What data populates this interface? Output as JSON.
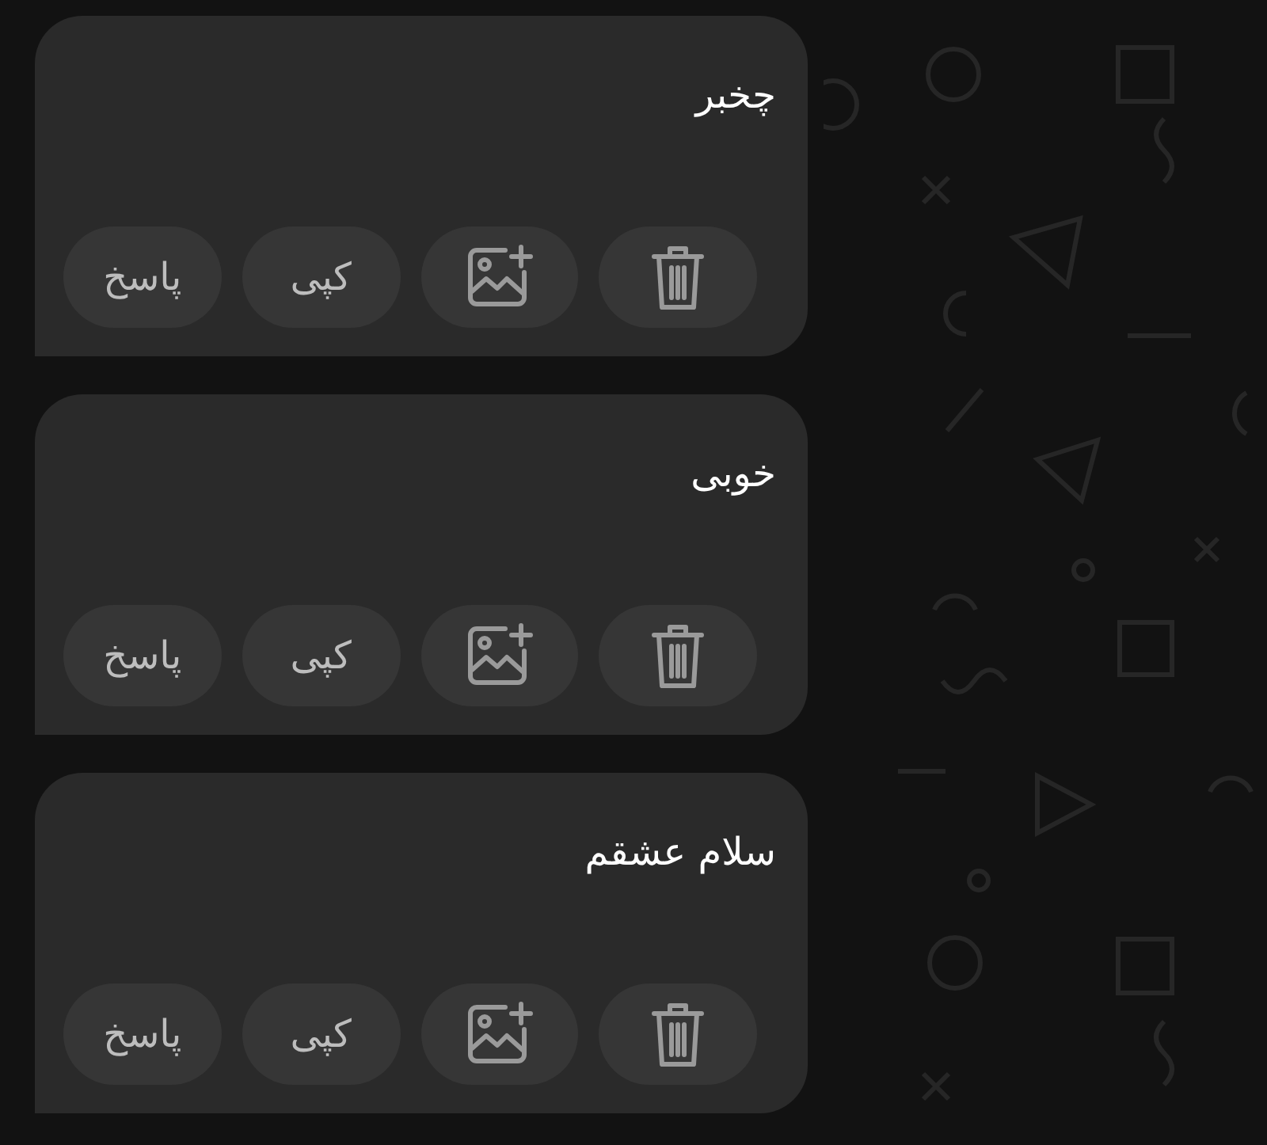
{
  "messages": [
    {
      "text": "چخبر",
      "actions": [
        {
          "kind": "delete"
        },
        {
          "kind": "add-image"
        },
        {
          "kind": "text",
          "label": "کپی"
        },
        {
          "kind": "text",
          "label": "پاسخ"
        }
      ]
    },
    {
      "text": "خوبی",
      "actions": [
        {
          "kind": "delete"
        },
        {
          "kind": "add-image"
        },
        {
          "kind": "text",
          "label": "کپی"
        },
        {
          "kind": "text",
          "label": "پاسخ"
        }
      ]
    },
    {
      "text": "سلام عشقم",
      "actions": [
        {
          "kind": "delete"
        },
        {
          "kind": "add-image"
        },
        {
          "kind": "text",
          "label": "کپی"
        },
        {
          "kind": "text",
          "label": "پاسخ"
        }
      ]
    }
  ]
}
